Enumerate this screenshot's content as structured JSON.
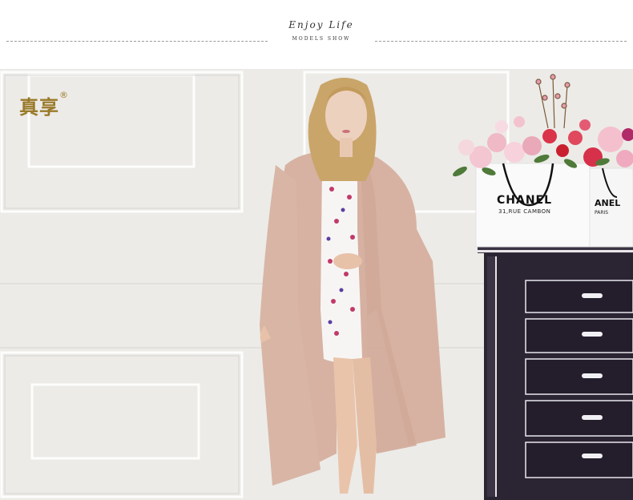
{
  "header": {
    "script_title": "Enjoy Life",
    "subtitle": "MODELS SHOW"
  },
  "photo": {
    "brand_logo": "真享",
    "brand_mark": "®",
    "bag_left_brand": "CHANEL",
    "bag_left_address": "31,RUE CAMBON",
    "bag_right_brand": "ANEL",
    "bag_right_city": "PARIS"
  },
  "colors": {
    "brand_gold": "#9a7a2a",
    "wall": "#ecebe7",
    "scarf": "#d8b3a3",
    "dresser": "#2a2433"
  }
}
